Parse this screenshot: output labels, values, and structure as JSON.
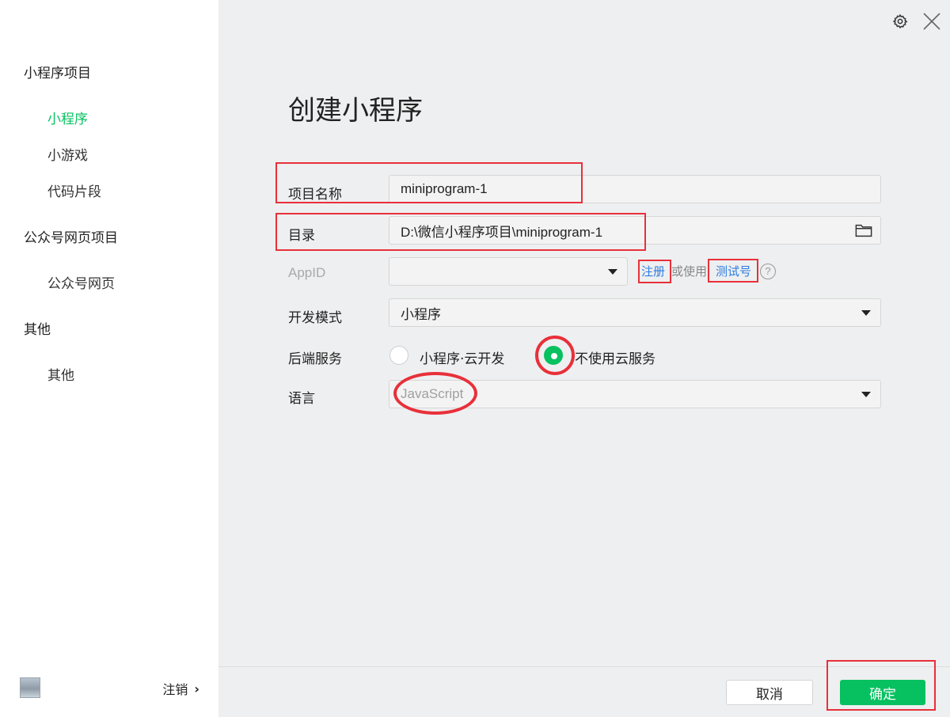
{
  "sidebar": {
    "groups": [
      {
        "label": "小程序项目",
        "items": [
          "小程序",
          "小游戏",
          "代码片段"
        ]
      },
      {
        "label": "公众号网页项目",
        "items": [
          "公众号网页"
        ]
      },
      {
        "label": "其他",
        "items": [
          "其他"
        ]
      }
    ],
    "active_item": "小程序",
    "logout_label": "注销"
  },
  "header": {
    "icons": [
      "gear-icon",
      "close-icon"
    ]
  },
  "form": {
    "title": "创建小程序",
    "project_name": {
      "label": "项目名称",
      "value": "miniprogram-1"
    },
    "directory": {
      "label": "目录",
      "value": "D:\\微信小程序项目\\miniprogram-1"
    },
    "appid": {
      "label": "AppID",
      "value": "",
      "register_link": "注册",
      "or_use": "或使用",
      "test_link": "测试号",
      "help": "?"
    },
    "dev_mode": {
      "label": "开发模式",
      "value": "小程序"
    },
    "backend": {
      "label": "后端服务",
      "options": [
        "小程序·云开发",
        "不使用云服务"
      ],
      "selected": "不使用云服务"
    },
    "language": {
      "label": "语言",
      "value": "JavaScript"
    }
  },
  "footer": {
    "cancel_label": "取消",
    "confirm_label": "确定"
  },
  "colors": {
    "accent": "#07c160",
    "link": "#2e7de0",
    "annotation": "#e8303a"
  }
}
